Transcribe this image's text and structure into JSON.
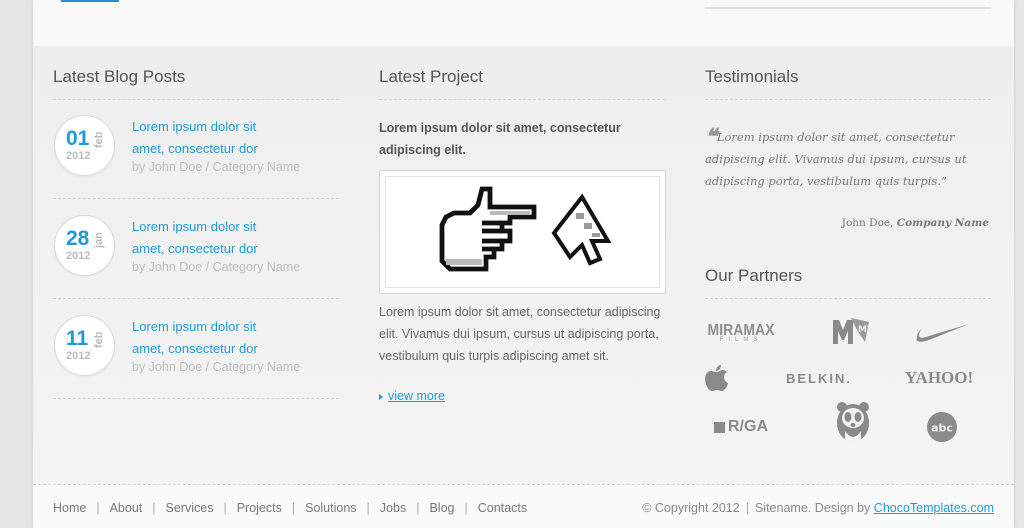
{
  "blog": {
    "heading": "Latest Blog Posts",
    "posts": [
      {
        "day": "01",
        "month": "feb",
        "year": "2012",
        "title": "Lorem ipsum dolor sit amet, consectetur dor",
        "meta": "by John Doe / Category Name"
      },
      {
        "day": "28",
        "month": "jan",
        "year": "2012",
        "title": "Lorem ipsum dolor sit amet, consectetur dor",
        "meta": "by John Doe / Category Name"
      },
      {
        "day": "11",
        "month": "feb",
        "year": "2012",
        "title": "Lorem ipsum dolor sit amet, consectetur dor",
        "meta": "by John Doe / Category Name"
      }
    ]
  },
  "project": {
    "heading": "Latest Project",
    "title": "Lorem ipsum dolor sit amet, consectetur adipiscing elit.",
    "description": "Lorem ipsum dolor sit amet, consectetur adipiscing elit. Vivamus dui ipsum, cursus ut adipiscing porta, vestibulum quis turpis adipiscing amet sit.",
    "view_more": "view more"
  },
  "testimonials": {
    "heading": "Testimonials",
    "quote": "Lorem ipsum dolor sit amet, consectetur adipiscing elit. Vivamus dui ipsum, cursus ut adipiscing porta, vestibulum quis turpis.",
    "author": "John Doe,",
    "company": "Company Name"
  },
  "partners": {
    "heading": "Our Partners",
    "logos": [
      "MIRAMAX",
      "FILMS",
      "MTV",
      "nike",
      "apple",
      "BELKIN.",
      "YAHOO!",
      "R/GA",
      "WWF",
      "abc"
    ]
  },
  "footer": {
    "nav": [
      "Home",
      "About",
      "Services",
      "Projects",
      "Solutions",
      "Jobs",
      "Blog",
      "Contacts"
    ],
    "copyright": "© Copyright 2012",
    "sitename": "Sitename. Design by",
    "designer": "ChocoTemplates.com"
  },
  "colors": {
    "accent": "#1e9ad9",
    "text": "#555555",
    "muted": "#bdbdbd"
  }
}
